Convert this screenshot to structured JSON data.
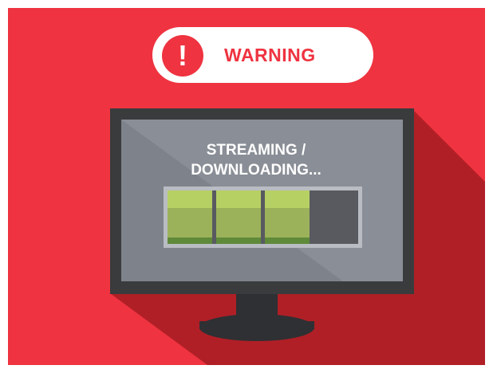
{
  "warning": {
    "icon": "exclamation-icon",
    "icon_glyph": "!",
    "label": "WARNING"
  },
  "screen": {
    "line1": "STREAMING /",
    "line2": "DOWNLOADING..."
  },
  "progress": {
    "segments_total": 4,
    "segments_filled": 3,
    "fraction": 0.75
  },
  "colors": {
    "background": "#ef3340",
    "shadow": "#b01f26",
    "accent_white": "#ffffff",
    "monitor_frame": "#3a3b3d",
    "screen": "#7e828a",
    "segment_fill": "#9cb25a",
    "segment_empty": "#585a60"
  }
}
